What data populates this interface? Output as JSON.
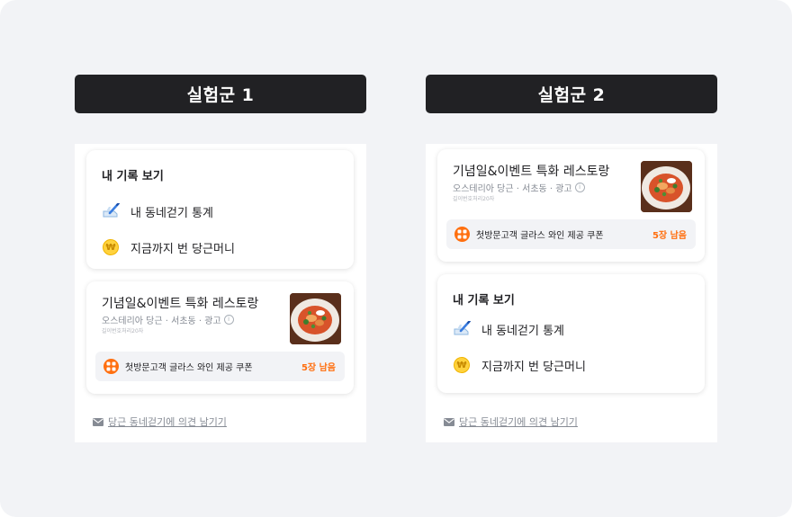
{
  "groups": [
    {
      "label": "실험군 1",
      "records": {
        "title": "내 기록 보기",
        "walk_stats": "내 동네걷기 통계",
        "carrot_money": "지금까지 번 당근머니",
        "walk_icon": "running-shoe-icon",
        "coin_icon": "won-coin-icon",
        "coin_symbol": "₩"
      },
      "ad": {
        "title": "기념일&이벤트 특화 레스토랑",
        "subtitle": "오스테리아 당근 · 서초동 · 광고",
        "info_symbol": "i",
        "tiny": "길이번호처리20자",
        "coupon_text": "첫방문고객 글라스 와인 제공 쿠폰",
        "coupon_count": "5장 남음"
      },
      "feedback": "당근 동네걷기에 의견 남기기"
    },
    {
      "label": "실험군 2",
      "records": {
        "title": "내 기록 보기",
        "walk_stats": "내 동네걷기 통계",
        "carrot_money": "지금까지 번 당근머니",
        "walk_icon": "running-shoe-icon",
        "coin_icon": "won-coin-icon",
        "coin_symbol": "₩"
      },
      "ad": {
        "title": "기념일&이벤트 특화 레스토랑",
        "subtitle": "오스테리아 당근 · 서초동 · 광고",
        "info_symbol": "i",
        "tiny": "길이번호처리20자",
        "coupon_text": "첫방문고객 글라스 와인 제공 쿠폰",
        "coupon_count": "5장 남음"
      },
      "feedback": "당근 동네걷기에 의견 남기기"
    }
  ],
  "colors": {
    "accent": "#ff6f0f",
    "label_bg": "#212124",
    "page_bg": "#f2f3f6"
  }
}
